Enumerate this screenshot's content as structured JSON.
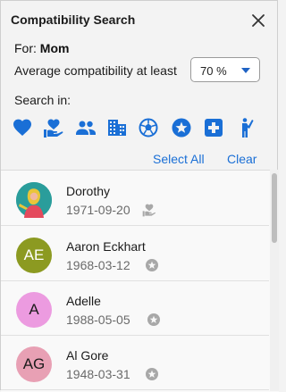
{
  "header": {
    "title": "Compatibility Search"
  },
  "for_label": "For:",
  "for_name": "Mom",
  "average": {
    "label": "Average compatibility at least",
    "selected": "70 %"
  },
  "search_in_label": "Search in:",
  "categories": [
    {
      "icon": "heart-icon",
      "color": "#1a6fd6"
    },
    {
      "icon": "heart-hand-icon",
      "color": "#1a6fd6"
    },
    {
      "icon": "people-icon",
      "color": "#1a6fd6"
    },
    {
      "icon": "building-icon",
      "color": "#1a6fd6"
    },
    {
      "icon": "soccer-ball-icon",
      "color": "#1a6fd6"
    },
    {
      "icon": "star-circle-icon",
      "color": "#1a6fd6"
    },
    {
      "icon": "medical-cross-icon",
      "color": "#1a6fd6"
    },
    {
      "icon": "person-pointing-icon",
      "color": "#1a6fd6"
    }
  ],
  "actions": {
    "select_all": "Select All",
    "clear": "Clear"
  },
  "results": [
    {
      "name": "Dorothy",
      "date": "1971-09-20",
      "initials": "",
      "avatar_color": "#2a9d9b",
      "tag_icon": "heart-hand-icon"
    },
    {
      "name": "Aaron Eckhart",
      "date": "1968-03-12",
      "initials": "AE",
      "avatar_color": "#8c9a21",
      "initials_color": "#ffffff",
      "tag_icon": "star-circle-icon"
    },
    {
      "name": "Adelle",
      "date": "1988-05-05",
      "initials": "A",
      "avatar_color": "#ec9be0",
      "initials_color": "#1b1b1b",
      "tag_icon": "star-circle-icon"
    },
    {
      "name": "Al Gore",
      "date": "1948-03-31",
      "initials": "AG",
      "avatar_color": "#e8a0b4",
      "initials_color": "#1b1b1b",
      "tag_icon": "star-circle-icon"
    }
  ]
}
